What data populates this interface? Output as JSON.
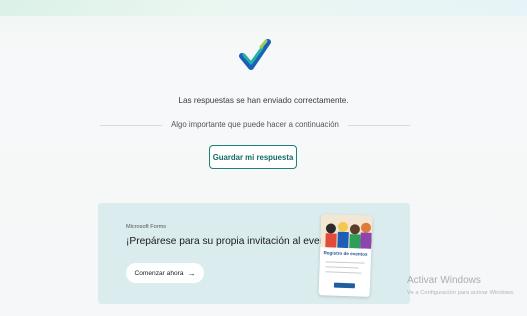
{
  "confirmation": {
    "sent_message": "Las respuestas se han enviado correctamente.",
    "next_steps_label": "Algo importante que puede hacer a continuación",
    "save_button": "Guardar mi respuesta"
  },
  "promo": {
    "brand": "Microsoft Forms",
    "headline": "¡Prepárese para su propia invitación al evento!",
    "cta_label": "Comenzar ahora",
    "cta_icon": "arrow-right-icon",
    "card_title": "Registro de eventos"
  },
  "watermark": {
    "title": "Activar Windows",
    "subtitle": "Ve a Configuración para activar Windows."
  },
  "colors": {
    "accent": "#1f7f79",
    "promo_bg": "#daecee",
    "check_teal": "#1aa29a",
    "check_blue": "#1d5fb6"
  }
}
